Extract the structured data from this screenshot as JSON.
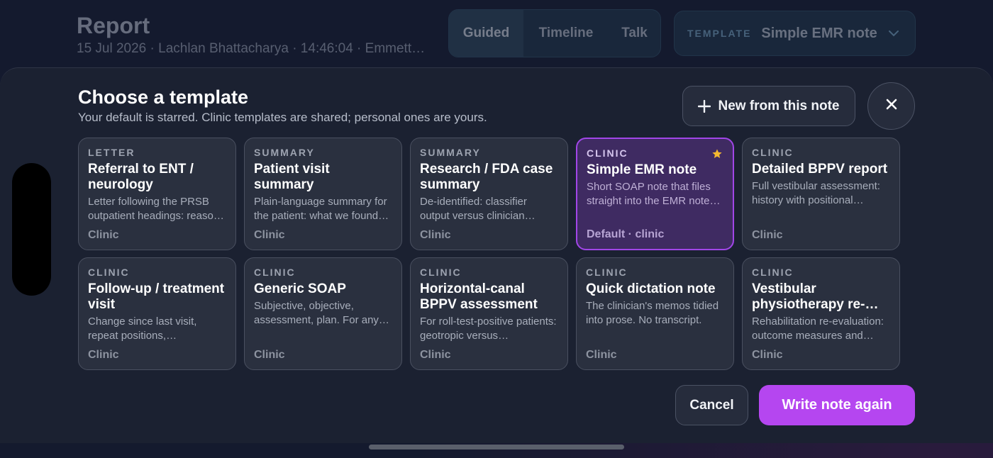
{
  "header": {
    "title": "Report",
    "meta": "15 Jul 2026 · Lachlan Bhattacharya · 14:46:04 · Emmett…",
    "modes": [
      {
        "label": "Guided",
        "active": true
      },
      {
        "label": "Timeline",
        "active": false
      },
      {
        "label": "Talk",
        "active": false
      }
    ],
    "template_select": {
      "label": "TEMPLATE",
      "value": "Simple EMR note",
      "icon": "chevron-down-icon"
    }
  },
  "sheet": {
    "title": "Choose a template",
    "subtitle": "Your default is starred. Clinic templates are shared; personal ones are yours.",
    "new_button": "New from this note",
    "new_icon": "plus-icon",
    "close_icon": "close-icon",
    "cancel_button": "Cancel",
    "primary_button": "Write note again",
    "accent_color": "#b546f0",
    "star_color": "#f4b830",
    "templates": [
      {
        "kind": "LETTER",
        "name": "Referral to ENT / neurology",
        "desc": "Letter following the PRSB outpatient headings: reason for referral, history, findings.",
        "foot": "Clinic",
        "selected": false,
        "starred": false
      },
      {
        "kind": "SUMMARY",
        "name": "Patient visit summary",
        "desc": "Plain-language summary for the patient: what we found and what happens next.",
        "foot": "Clinic",
        "selected": false,
        "starred": false
      },
      {
        "kind": "SUMMARY",
        "name": "Research / FDA case summary",
        "desc": "De-identified: classifier output versus clinician verdict.",
        "foot": "Clinic",
        "selected": false,
        "starred": false
      },
      {
        "kind": "CLINIC",
        "name": "Simple EMR note",
        "desc": "Short SOAP note that files straight into the EMR note field.",
        "foot": "Default · clinic",
        "selected": true,
        "starred": true
      },
      {
        "kind": "CLINIC",
        "name": "Detailed BPPV report",
        "desc": "Full vestibular assessment: history with positional testing.",
        "foot": "Clinic",
        "selected": false,
        "starred": false
      },
      {
        "kind": "CLINIC",
        "name": "Follow-up / treatment visit",
        "desc": "Change since last visit, repeat positions, manoeuvres performed.",
        "foot": "Clinic",
        "selected": false,
        "starred": false
      },
      {
        "kind": "CLINIC",
        "name": "Generic SOAP",
        "desc": "Subjective, objective, assessment, plan. For any visit type.",
        "foot": "Clinic",
        "selected": false,
        "starred": false
      },
      {
        "kind": "CLINIC",
        "name": "Horizontal-canal BPPV assessment",
        "desc": "For roll-test-positive patients: geotropic versus apogeotropic.",
        "foot": "Clinic",
        "selected": false,
        "starred": false
      },
      {
        "kind": "CLINIC",
        "name": "Quick dictation note",
        "desc": "The clinician's memos tidied into prose. No transcript.",
        "foot": "Clinic",
        "selected": false,
        "starred": false
      },
      {
        "kind": "CLINIC",
        "name": "Vestibular physiotherapy re-evaluation",
        "desc": "Rehabilitation re-evaluation: outcome measures and goals.",
        "foot": "Clinic",
        "selected": false,
        "starred": false
      }
    ]
  }
}
